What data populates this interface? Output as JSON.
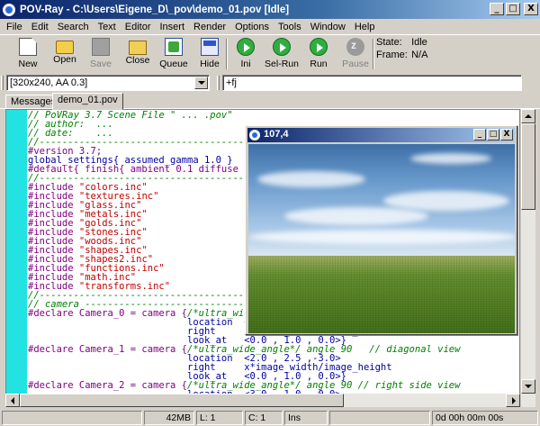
{
  "window": {
    "title": "POV-Ray - C:\\Users\\Eigene_D\\_pov\\demo_01.pov [Idle]",
    "min": "_",
    "max": "□",
    "close": "X"
  },
  "menu": [
    "File",
    "Edit",
    "Search",
    "Text",
    "Editor",
    "Insert",
    "Render",
    "Options",
    "Tools",
    "Window",
    "Help"
  ],
  "toolbar": {
    "new": "New",
    "open": "Open",
    "save": "Save",
    "close": "Close",
    "queue": "Queue",
    "hide": "Hide",
    "ini": "Ini",
    "sel_run": "Sel-Run",
    "run": "Run",
    "pause": "Pause"
  },
  "status": {
    "state_label": "State:",
    "state_value": "Idle",
    "frame_label": "Frame:",
    "frame_value": "N/A"
  },
  "options": {
    "resolution": "[320x240, AA 0.3]",
    "command_line": "+fj"
  },
  "tabs": [
    "Messages",
    "demo_01.pov"
  ],
  "editor": {
    "lines": [
      [
        {
          "t": "// PoVRay 3.7 Scene File \" ... .pov\"",
          "c": "c-cm"
        }
      ],
      [
        {
          "t": "// author:  ...",
          "c": "c-cm"
        }
      ],
      [
        {
          "t": "// date:    ...",
          "c": "c-cm"
        }
      ],
      [
        {
          "t": "//--------------------------------------------------------------------------",
          "c": "c-cm"
        }
      ],
      [
        {
          "t": "#version 3.7;",
          "c": "c-kw"
        }
      ],
      [
        {
          "t": "global_settings{ assumed_gamma 1.0 }",
          "c": "c-id"
        }
      ],
      [
        {
          "t": "#default{ finish{ ambient 0.1 diffuse 0.9 }}",
          "c": "c-kw"
        }
      ],
      [
        {
          "t": "//--------------------------------------------------------------------------",
          "c": "c-cm"
        }
      ],
      [
        {
          "t": "#include ",
          "c": "c-kw"
        },
        {
          "t": "\"colors.inc\"",
          "c": "c-str"
        }
      ],
      [
        {
          "t": "#include ",
          "c": "c-kw"
        },
        {
          "t": "\"textures.inc\"",
          "c": "c-str"
        }
      ],
      [
        {
          "t": "#include ",
          "c": "c-kw"
        },
        {
          "t": "\"glass.inc\"",
          "c": "c-str"
        }
      ],
      [
        {
          "t": "#include ",
          "c": "c-kw"
        },
        {
          "t": "\"metals.inc\"",
          "c": "c-str"
        }
      ],
      [
        {
          "t": "#include ",
          "c": "c-kw"
        },
        {
          "t": "\"golds.inc\"",
          "c": "c-str"
        }
      ],
      [
        {
          "t": "#include ",
          "c": "c-kw"
        },
        {
          "t": "\"stones.inc\"",
          "c": "c-str"
        }
      ],
      [
        {
          "t": "#include ",
          "c": "c-kw"
        },
        {
          "t": "\"woods.inc\"",
          "c": "c-str"
        }
      ],
      [
        {
          "t": "#include ",
          "c": "c-kw"
        },
        {
          "t": "\"shapes.inc\"",
          "c": "c-str"
        }
      ],
      [
        {
          "t": "#include ",
          "c": "c-kw"
        },
        {
          "t": "\"shapes2.inc\"",
          "c": "c-str"
        }
      ],
      [
        {
          "t": "#include ",
          "c": "c-kw"
        },
        {
          "t": "\"functions.inc\"",
          "c": "c-str"
        }
      ],
      [
        {
          "t": "#include ",
          "c": "c-kw"
        },
        {
          "t": "\"math.inc\"",
          "c": "c-str"
        }
      ],
      [
        {
          "t": "#include ",
          "c": "c-kw"
        },
        {
          "t": "\"transforms.inc\"",
          "c": "c-str"
        }
      ],
      [
        {
          "t": "//--------------------------------------------------------------------------",
          "c": "c-cm"
        }
      ],
      [
        {
          "t": "// camera ------------------------------------------------------------------",
          "c": "c-cm"
        }
      ],
      [
        {
          "t": "#declare Camera_0 = camera {",
          "c": "c-kw"
        },
        {
          "t": "/*ultra_wide_angle*/ angle 75   // front view",
          "c": "c-cm"
        }
      ],
      [
        {
          "t": "                            location  <0.0 , 1.0 ,-3.0>",
          "c": "c-id"
        }
      ],
      [
        {
          "t": "                            right     x*image_width/image_height",
          "c": "c-id"
        }
      ],
      [
        {
          "t": "                            look_at   <0.0 , 1.0 , 0.0>}",
          "c": "c-id"
        }
      ],
      [
        {
          "t": "#declare Camera_1 = camera {",
          "c": "c-kw"
        },
        {
          "t": "/*ultra_wide_angle*/ angle 90   // diagonal view",
          "c": "c-cm"
        }
      ],
      [
        {
          "t": "                            location  <2.0 , 2.5 ,-3.0>",
          "c": "c-id"
        }
      ],
      [
        {
          "t": "                            right     x*image_width/image_height",
          "c": "c-id"
        }
      ],
      [
        {
          "t": "                            look_at   <0.0 , 1.0 , 0.0>}",
          "c": "c-id"
        }
      ],
      [
        {
          "t": "#declare Camera_2 = camera {",
          "c": "c-kw"
        },
        {
          "t": "/*ultra_wide_angle*/ angle 90 // right side view",
          "c": "c-cm"
        }
      ],
      [
        {
          "t": "                            location  <3.0 , 1.0 , 0.0>",
          "c": "c-id"
        }
      ]
    ]
  },
  "render_window": {
    "title": "107,4"
  },
  "statusbar": {
    "memory": "42MB",
    "line": "L: 1",
    "col": "C: 1",
    "mode": "Ins",
    "time": "0d 00h 00m 00s"
  }
}
